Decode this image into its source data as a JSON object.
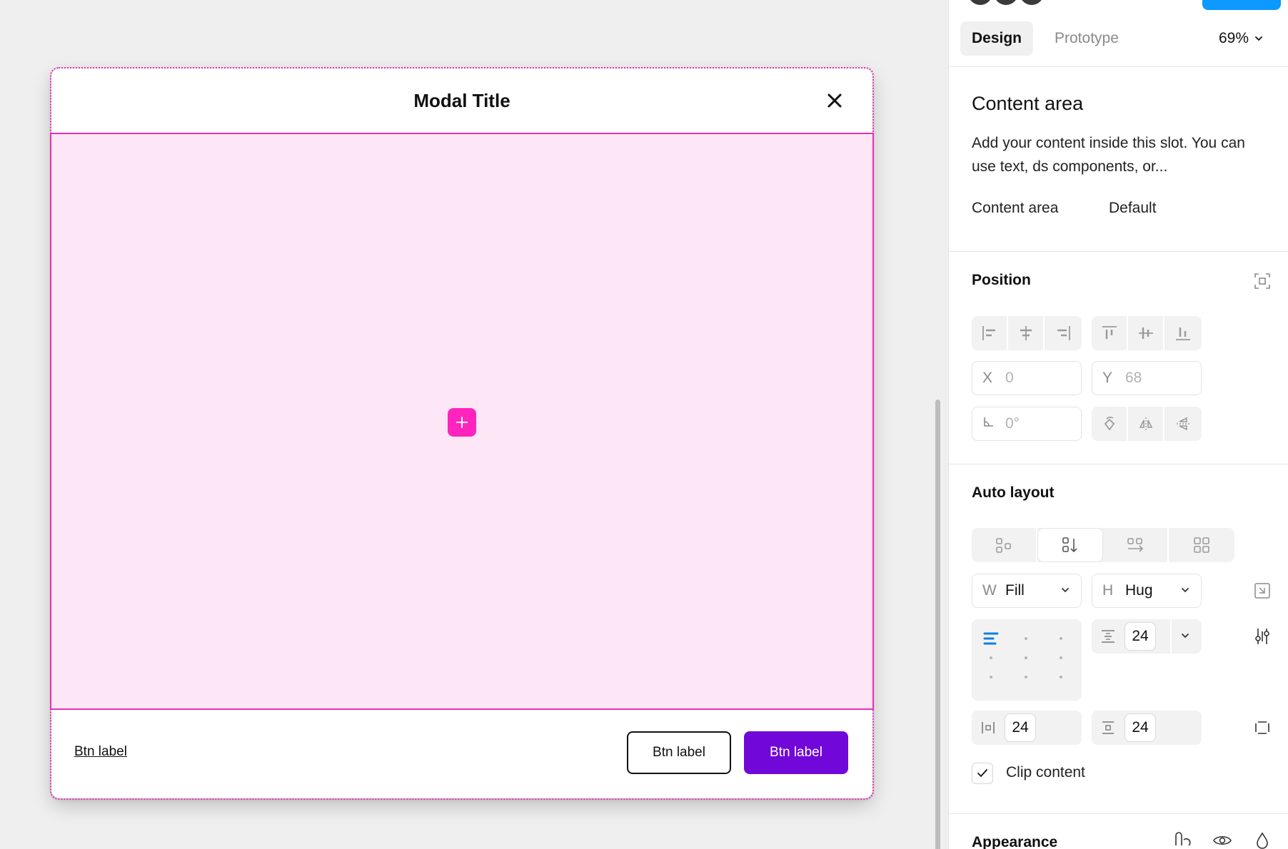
{
  "modal": {
    "title": "Modal Title",
    "footer": {
      "link_label": "Btn label",
      "secondary_label": "Btn label",
      "primary_label": "Btn label"
    }
  },
  "panel": {
    "tabs": [
      {
        "label": "Design",
        "active": true
      },
      {
        "label": "Prototype",
        "active": false
      }
    ],
    "zoom": "69%",
    "content_area": {
      "title": "Content area",
      "description": "Add your content inside this slot. You can use text, ds components, or...",
      "property_label": "Content area",
      "property_value": "Default"
    },
    "position": {
      "title": "Position",
      "x_label": "X",
      "x_value": "0",
      "y_label": "Y",
      "y_value": "68",
      "rotation_value": "0°"
    },
    "auto_layout": {
      "title": "Auto layout",
      "width_label": "W",
      "width_value": "Fill",
      "height_label": "H",
      "height_value": "Hug",
      "gap": "24",
      "horizontal_padding": "24",
      "vertical_padding": "24",
      "clip_content_label": "Clip content",
      "clip_content_checked": true
    },
    "appearance": {
      "title": "Appearance"
    }
  },
  "colors": {
    "slot_fill": "#fde6f6",
    "slot_border": "#e62fb9",
    "slot_add_button": "#ff24bd",
    "primary_button": "#7107d9",
    "share_button": "#0d99ff"
  }
}
